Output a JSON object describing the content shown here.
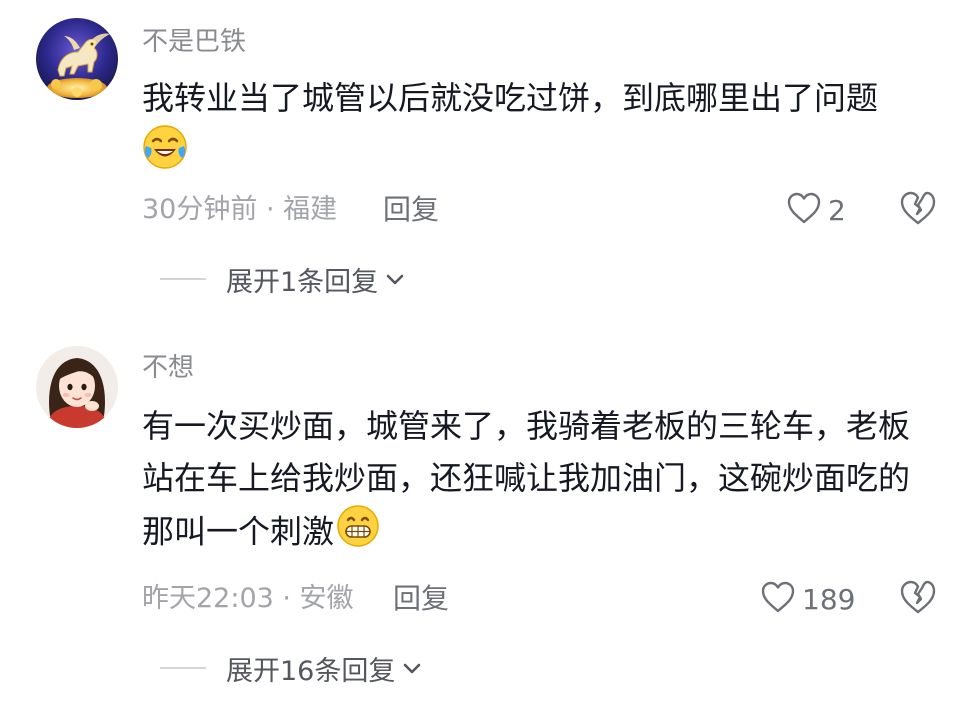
{
  "comments": [
    {
      "username": "不是巴铁",
      "avatar": "golden-horse-avatar",
      "text": "我转业当了城管以后就没吃过饼，到底哪里出了问题",
      "emoji": "crying-laughing-emoji",
      "time_location": "30分钟前 · 福建",
      "reply_label": "回复",
      "likes": "2",
      "expand_label": "展开1条回复"
    },
    {
      "username": "不想",
      "avatar": "cartoon-girl-avatar",
      "text": "有一次买炒面，城管来了，我骑着老板的三轮车，老板站在车上给我炒面，还狂喊让我加油门，这碗炒面吃的那叫一个刺激",
      "emoji": "grinning-teeth-emoji",
      "time_location": "昨天22:03 · 安徽",
      "reply_label": "回复",
      "likes": "189",
      "expand_label": "展开16条回复"
    }
  ],
  "icons": {
    "like": "heart-outline-icon",
    "dislike": "broken-heart-icon",
    "expand": "chevron-down-icon"
  },
  "colors": {
    "primary_text": "#161823",
    "username": "#8a8b91",
    "meta": "#a3a4a9",
    "action": "#6e7078"
  }
}
